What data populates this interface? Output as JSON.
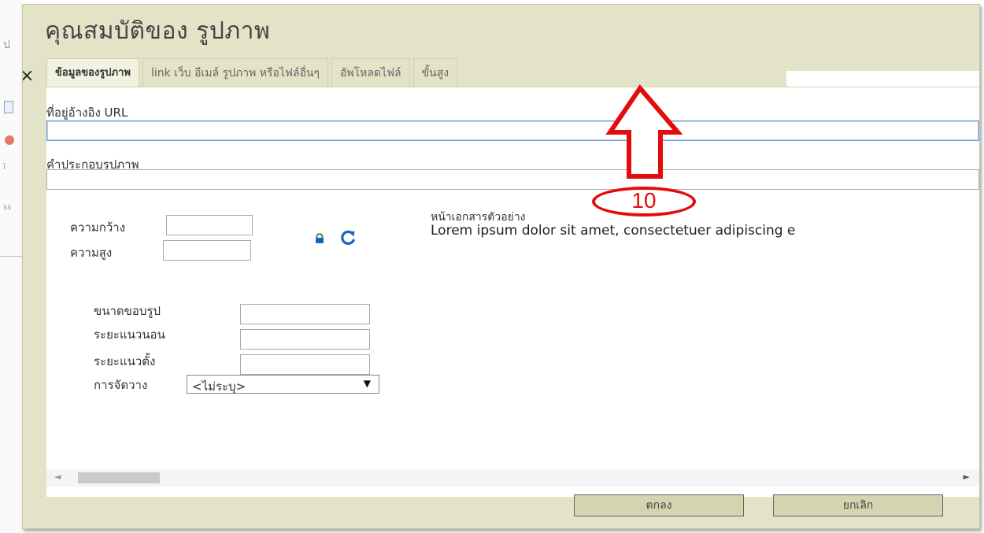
{
  "background": {
    "fragments": [
      "ป",
      "ss",
      "ï"
    ]
  },
  "dialog": {
    "title": "คุณสมบัติของ รูปภาพ",
    "close_glyph": "×"
  },
  "tabs": [
    {
      "label": "ข้อมูลของรูปภาพ",
      "active": true
    },
    {
      "label": "link เว็บ อีเมล์ รูปภาพ หรือไฟล์อื่นๆ",
      "active": false
    },
    {
      "label": "อัพโหลดไฟล์",
      "active": false
    },
    {
      "label": "ขั้นสูง",
      "active": false
    }
  ],
  "form": {
    "url_label": "ที่อยู่อ้างอิง URL",
    "url_value": "",
    "alt_label": "คำประกอบรูปภาพ",
    "alt_value": "",
    "width_label": "ความกว้าง",
    "width_value": "",
    "height_label": "ความสูง",
    "height_value": "",
    "border_label": "ขนาดขอบรูป",
    "border_value": "",
    "hspace_label": "ระยะแนวนอน",
    "hspace_value": "",
    "vspace_label": "ระยะแนวตั้ง",
    "vspace_value": "",
    "align_label": "การจัดวาง",
    "align_value": "<ไม่ระบุ>"
  },
  "preview": {
    "label": "หน้าเอกสารตัวอย่าง",
    "text": "Lorem ipsum dolor sit amet, consectetuer adipiscing e"
  },
  "buttons": {
    "ok": "ตกลง",
    "cancel": "ยกเลิก"
  },
  "annotation": {
    "number": "10",
    "color": "#e40b0b"
  },
  "icons": {
    "lock": "lock-icon",
    "reset": "refresh-icon",
    "dropdown": "▼",
    "scroll_left": "◄",
    "scroll_right": "►"
  }
}
